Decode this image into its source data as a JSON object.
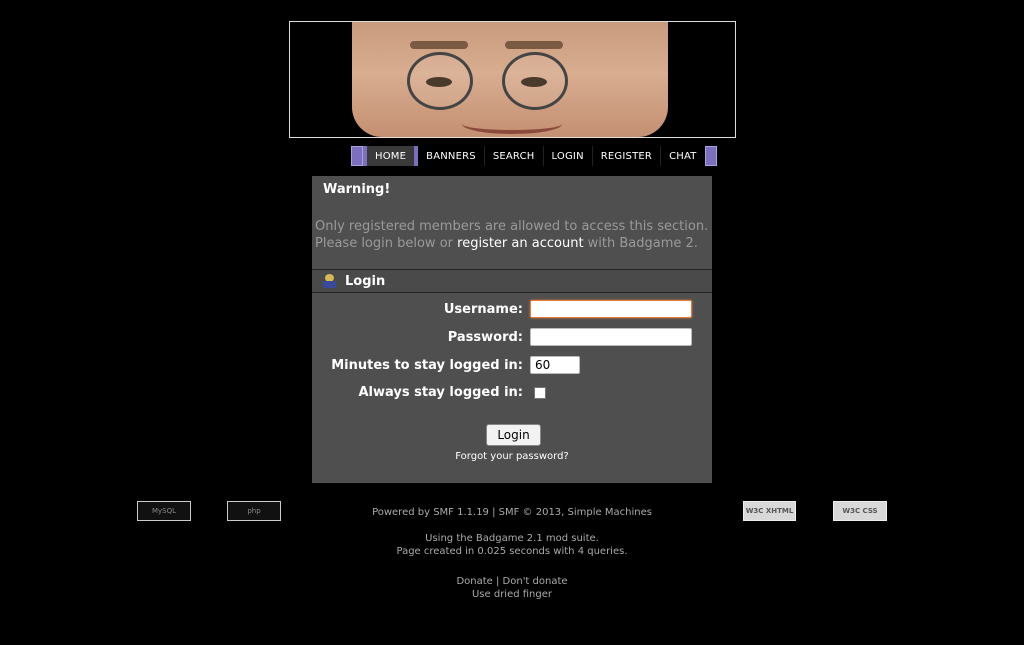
{
  "nav": {
    "items": [
      "HOME",
      "BANNERS",
      "SEARCH",
      "LOGIN",
      "REGISTER",
      "CHAT"
    ]
  },
  "warning": {
    "title": "Warning!",
    "line1": "Only registered members are allowed to access this section.",
    "line2_prefix": "Please login below or ",
    "register_link": "register an account",
    "line2_suffix": " with Badgame 2."
  },
  "login": {
    "title": "Login",
    "username_label": "Username:",
    "password_label": "Password:",
    "minutes_label": "Minutes to stay logged in:",
    "minutes_value": "60",
    "always_label": "Always stay logged in:",
    "submit_label": "Login",
    "forgot_label": "Forgot your password?"
  },
  "footer": {
    "powered": "Powered by SMF 1.1.19 | SMF © 2013, Simple Machines",
    "suite": "Using the Badgame 2.1 mod suite.",
    "timing": "Page created in 0.025 seconds with 4 queries.",
    "donate": "Donate",
    "sep": " | ",
    "dont_donate": "Don't donate",
    "dried": "Use dried finger"
  },
  "badges": {
    "mysql": "MySQL",
    "php": "php",
    "xhtml": "W3C XHTML 1.0",
    "css": "W3C CSS"
  },
  "colors": {
    "accent": "#7c6fbd",
    "panel": "#4f4f4f",
    "focus": "#e07a3a"
  }
}
